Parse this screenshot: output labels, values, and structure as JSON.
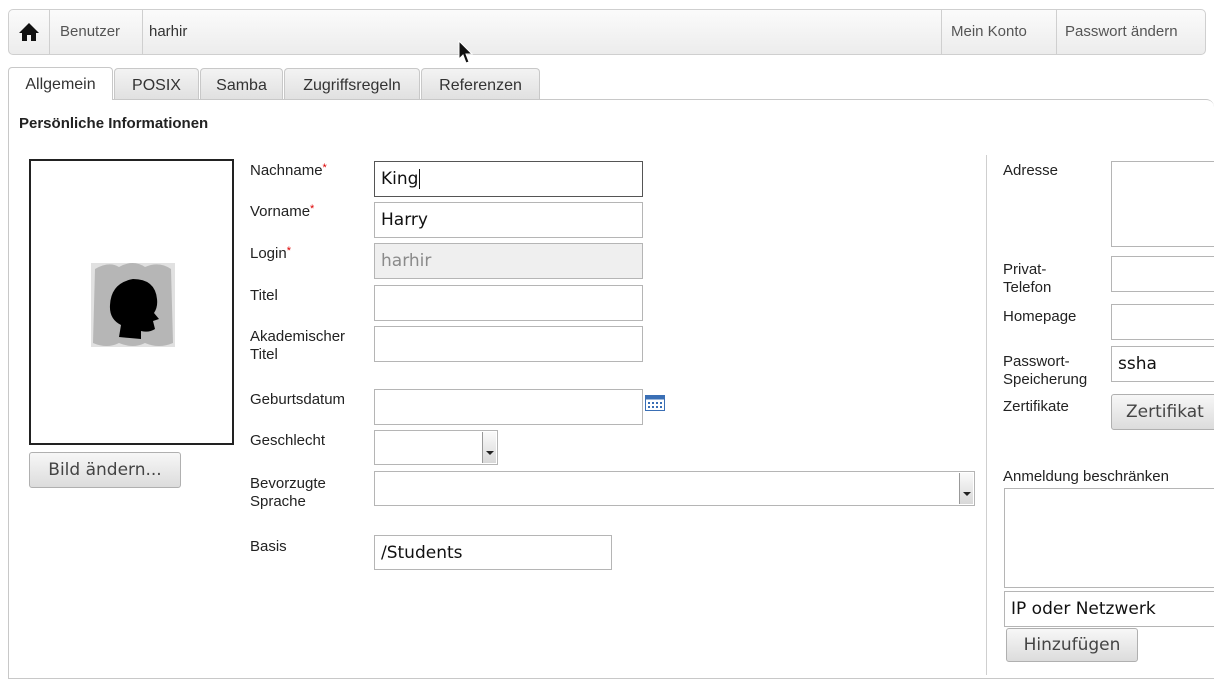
{
  "breadcrumb": {
    "section": "Benutzer",
    "user": "harhir",
    "my_account": "Mein Konto",
    "change_password": "Passwort ändern"
  },
  "tabs": [
    {
      "label": "Allgemein",
      "active": true
    },
    {
      "label": "POSIX"
    },
    {
      "label": "Samba"
    },
    {
      "label": "Zugriffsregeln"
    },
    {
      "label": "Referenzen"
    }
  ],
  "section_title": "Persönliche Informationen",
  "photo": {
    "change_button": "Bild ändern..."
  },
  "form": {
    "nachname": {
      "label": "Nachname",
      "value": "King"
    },
    "vorname": {
      "label": "Vorname",
      "value": "Harry"
    },
    "login": {
      "label": "Login",
      "value": "harhir"
    },
    "titel": {
      "label": "Titel",
      "value": ""
    },
    "akad_titel": {
      "label_1": "Akademischer",
      "label_2": "Titel",
      "value": ""
    },
    "geburtsdatum": {
      "label": "Geburtsdatum",
      "value": ""
    },
    "geschlecht": {
      "label": "Geschlecht",
      "value": ""
    },
    "sprache": {
      "label_1": "Bevorzugte",
      "label_2": "Sprache",
      "value": ""
    },
    "basis": {
      "label": "Basis",
      "value": "/Students"
    },
    "required_mark": "*"
  },
  "right": {
    "adresse": {
      "label": "Adresse"
    },
    "privat_telefon": {
      "label_1": "Privat-",
      "label_2": "Telefon"
    },
    "homepage": {
      "label": "Homepage"
    },
    "passwort_speicherung": {
      "label_1": "Passwort-",
      "label_2": "Speicherung",
      "value": "ssha"
    },
    "zertifikate": {
      "label": "Zertifikate",
      "button": "Zertifikat"
    },
    "anmeldung": {
      "label": "Anmeldung beschränken"
    },
    "ip_input": {
      "value": "IP oder Netzwerk"
    },
    "add_button": "Hinzufügen"
  }
}
